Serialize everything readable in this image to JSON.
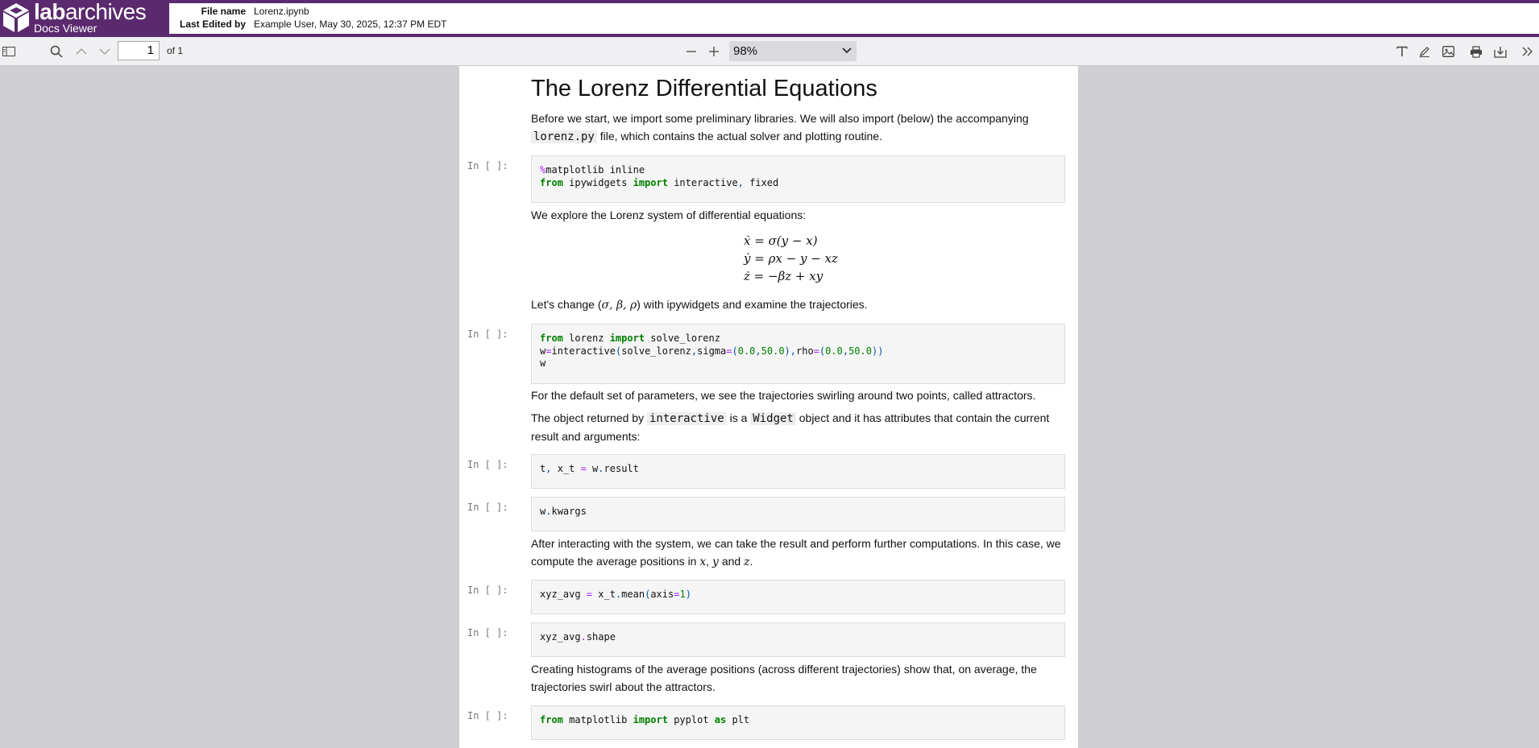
{
  "brand": {
    "name_bold": "lab",
    "name_rest": "archives",
    "subtitle": "Docs Viewer"
  },
  "file": {
    "name_label": "File name",
    "name_value": "Lorenz.ipynb",
    "edited_label": "Last Edited by",
    "edited_value": "Example User, May 30, 2025, 12:37 PM EDT"
  },
  "toolbar": {
    "page_value": "1",
    "of_pages": "of 1",
    "zoom": "98%"
  },
  "notebook": {
    "title": "The Lorenz Differential Equations",
    "intro_1": "Before we start, we import some preliminary libraries. We will also import (below) the accompanying ",
    "intro_code": "lorenz.py",
    "intro_2": " file, which contains the actual solver and plotting routine.",
    "prompt": "In [ ]:",
    "explore": "We explore the Lorenz system of differential equations:",
    "eq1": "ẋ = σ(y − x)",
    "eq2": "ẏ = ρx − y − xz",
    "eq3": "ż = −βz + xy",
    "change_1": "Let's change (",
    "change_params": "σ, β, ρ",
    "change_2": ") with ipywidgets and examine the trajectories.",
    "default_params": "For the default set of parameters, we see the trajectories swirling around two points, called attractors.",
    "obj_1": "The object returned by ",
    "obj_code1": "interactive",
    "obj_2": " is a ",
    "obj_code2": "Widget",
    "obj_3": " object and it has attributes that contain the current result and arguments:",
    "after_1": "After interacting with the system, we can take the result and perform further computations. In this case, we compute the average positions in ",
    "after_x": "x",
    "after_y": "y",
    "after_and": " and ",
    "after_z": "z",
    "after_end": ".",
    "hist": "Creating histograms of the average positions (across different trajectories) show that, on average, the trajectories swirl about the attractors."
  }
}
